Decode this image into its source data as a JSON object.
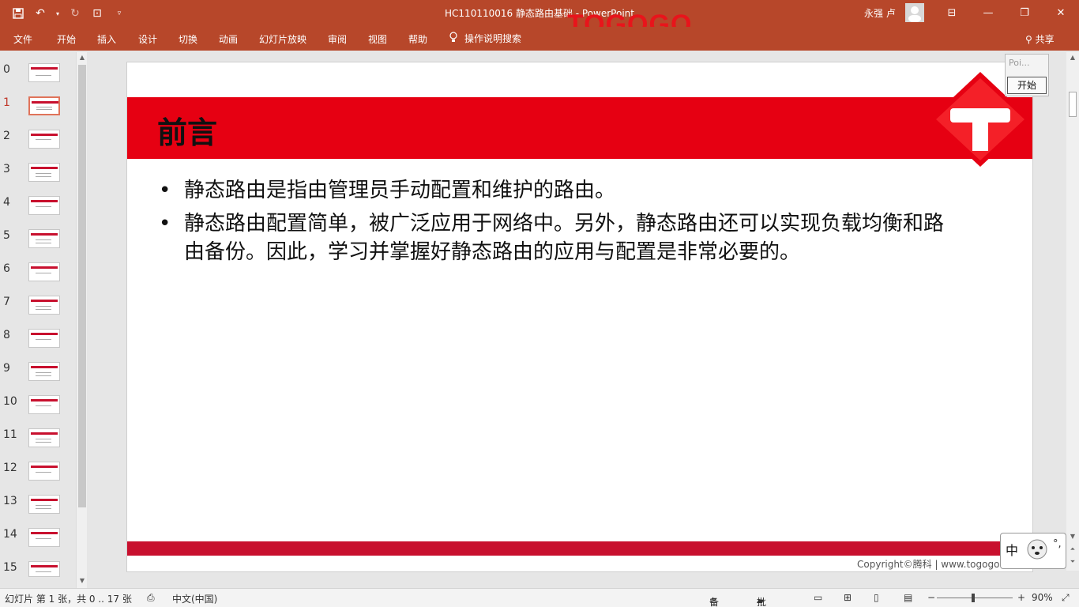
{
  "titlebar": {
    "doc_title": "HC110110016 静态路由基础  -  PowerPoint",
    "brand": "TOGOGO",
    "user": "永强 卢"
  },
  "ribbon": {
    "tabs": [
      "文件",
      "开始",
      "插入",
      "设计",
      "切换",
      "动画",
      "幻灯片放映",
      "审阅",
      "视图",
      "帮助"
    ],
    "tellme": "操作说明搜索",
    "share": "共享"
  },
  "thumbnails": {
    "numbers": [
      "0",
      "1",
      "2",
      "3",
      "4",
      "5",
      "6",
      "7",
      "8",
      "9",
      "10",
      "11",
      "12",
      "13",
      "14",
      "15"
    ],
    "selected_index": 1
  },
  "slide": {
    "title": "前言",
    "bullets": [
      "静态路由是指由管理员手动配置和维护的路由。",
      "静态路由配置简单，被广泛应用于网络中。另外，静态路由还可以实现负载均衡和路由备份。因此，学习并掌握好静态路由的应用与配置是非常必要的。"
    ],
    "copyright": "Copyright©腾科 | www.togogo",
    "band_color": "#e60012",
    "footer_color": "#c8102e"
  },
  "popup": {
    "placeholder": "Poi...",
    "start": "开始"
  },
  "ime": {
    "mode": "中",
    "punct": "°,"
  },
  "status": {
    "slide_info": "幻灯片 第 1 张，共 0 .. 17 张",
    "language": "中文(中国)",
    "notes": "备注",
    "comments": "批注",
    "zoom": "90%"
  },
  "colors": {
    "accent": "#b7472a"
  }
}
